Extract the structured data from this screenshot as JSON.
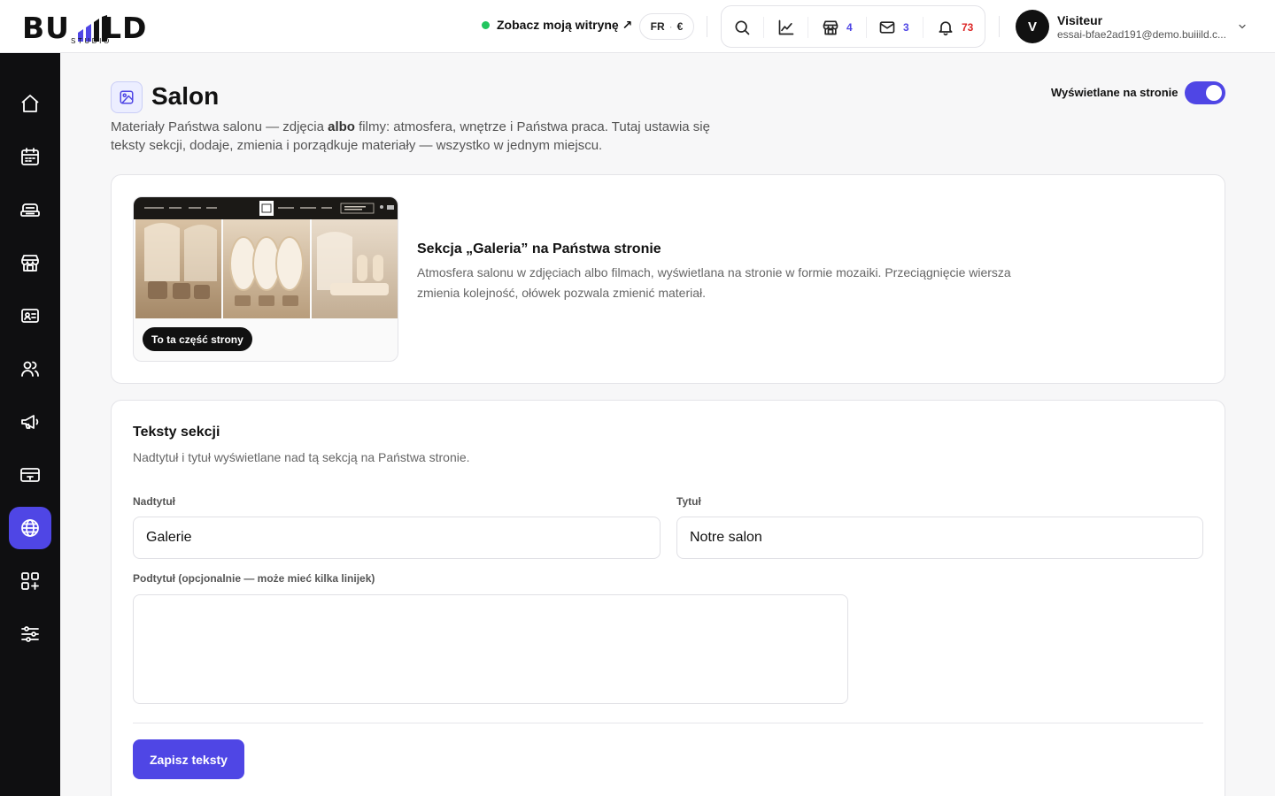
{
  "brand": {
    "logo_word_left": "BU",
    "logo_word_right": "LD",
    "logo_sub": "STUDIO"
  },
  "topbar": {
    "view_site_label": "Zobacz moją witrynę ↗",
    "lang": "FR",
    "currency": "€",
    "shop_count": "4",
    "mail_count": "3",
    "notif_count": "73",
    "colors": {
      "accent": "#4f46e5",
      "online": "#22c55e",
      "notif": "#dc2626"
    }
  },
  "user": {
    "initial": "V",
    "name": "Visiteur",
    "email": "essai-bfae2ad191@demo.buiiild.c..."
  },
  "sidebar": {
    "items": [
      {
        "icon": "home-icon"
      },
      {
        "icon": "calendar-icon"
      },
      {
        "icon": "service-icon"
      },
      {
        "icon": "store-icon"
      },
      {
        "icon": "id-card-icon"
      },
      {
        "icon": "users-icon"
      },
      {
        "icon": "megaphone-icon"
      },
      {
        "icon": "payment-card-icon"
      },
      {
        "icon": "globe-icon",
        "active": true
      },
      {
        "icon": "apps-add-icon"
      },
      {
        "icon": "sliders-icon"
      }
    ]
  },
  "page": {
    "title": "Salon",
    "desc_part1": "Materiały Państwa salonu — zdjęcia ",
    "desc_bold": "albo",
    "desc_part2": " filmy: atmosfera, wnętrze i Państwa praca. Tutaj ustawia się teksty sekcji, dodaje, zmienia i porządkuje materiały — wszystko w jednym miejscu.",
    "visible_label": "Wyświetlane na stronie",
    "visible_on": true
  },
  "section": {
    "preview_badge": "To ta część strony",
    "title": "Sekcja „Galeria” na Państwa stronie",
    "desc": "Atmosfera salonu w zdjęciach albo filmach, wyświetlana na stronie w formie mozaiki. Przeciągnięcie wiersza zmienia kolejność, ołówek pozwala zmienić materiał."
  },
  "texts": {
    "title": "Teksty sekcji",
    "desc": "Nadtytuł i tytuł wyświetlane nad tą sekcją na Państwa stronie.",
    "overline_label": "Nadtytuł",
    "overline_value": "Galerie",
    "heading_label": "Tytuł",
    "heading_value": "Notre salon",
    "subtitle_label": "Podtytuł (opcjonalnie — może mieć kilka linijek)",
    "subtitle_value": "",
    "save_label": "Zapisz teksty"
  }
}
